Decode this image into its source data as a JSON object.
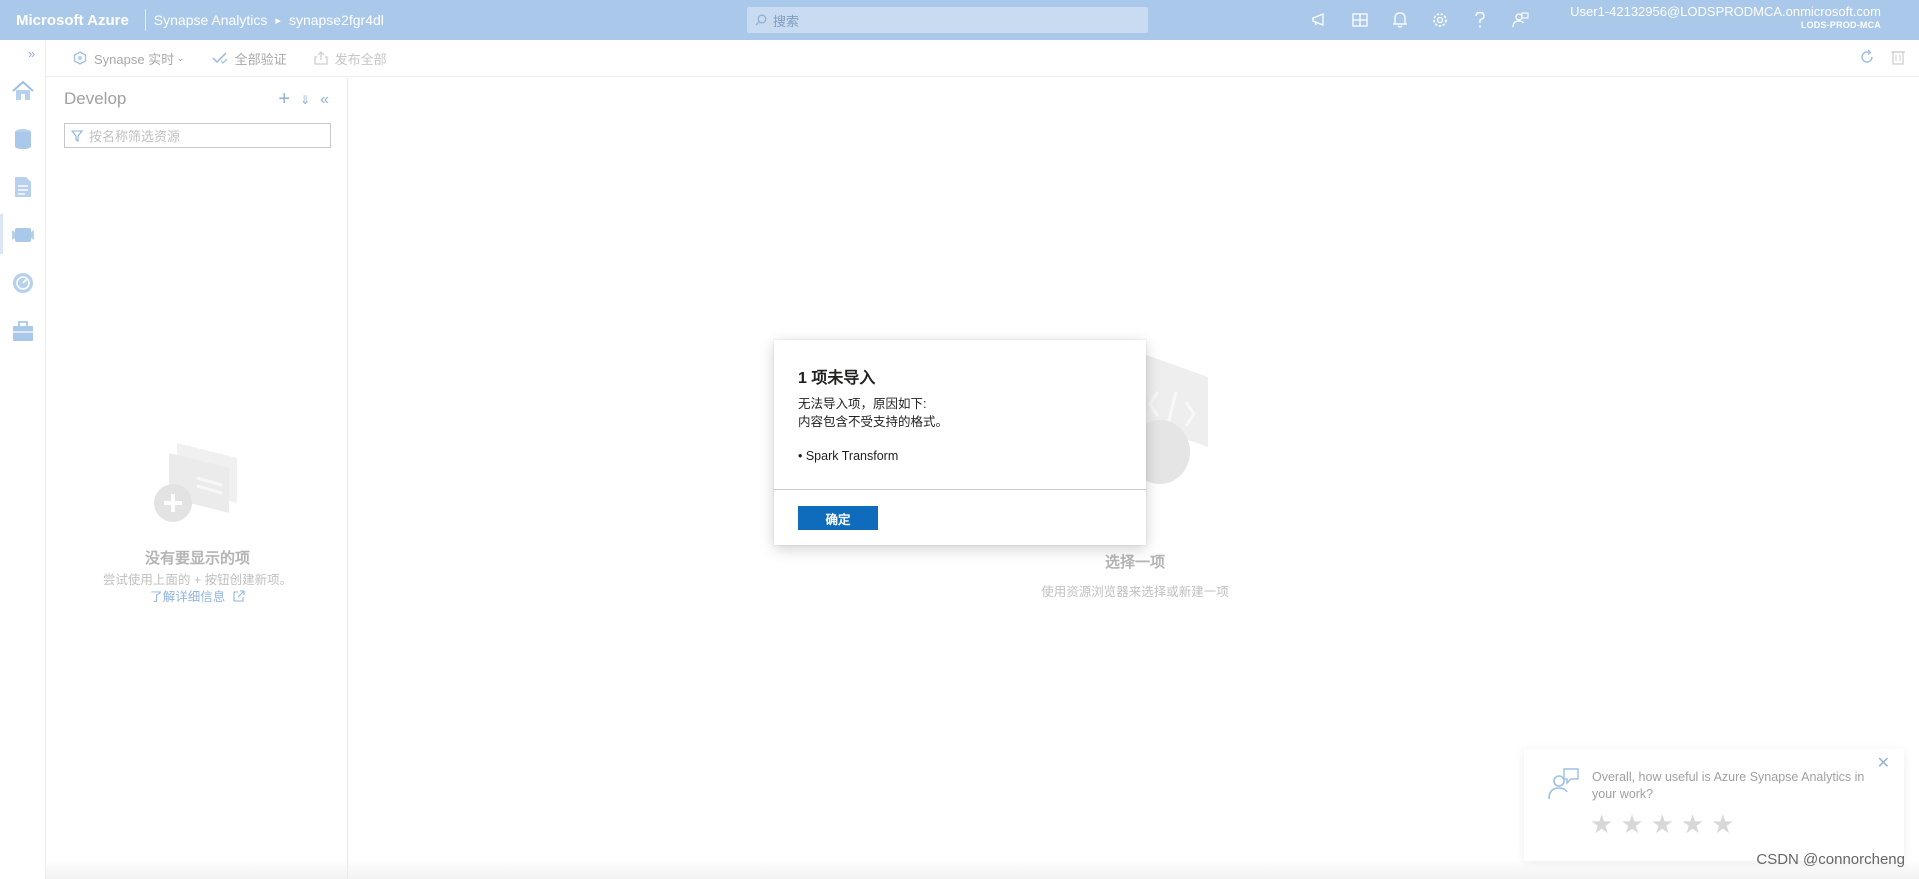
{
  "topbar": {
    "brand": "Microsoft Azure",
    "breadcrumb": [
      "Synapse Analytics",
      "synapse2fgr4dl"
    ],
    "search_placeholder": "搜索",
    "user_name": "User1-42132956@LODSPRODMCA.onmicrosoft.com",
    "user_org": "LODS-PROD-MCA",
    "icons": [
      "announcement-icon",
      "directory-icon",
      "bell-icon",
      "gear-icon",
      "help-icon",
      "feedback-icon"
    ]
  },
  "commandbar": {
    "live_label": "Synapse 实时",
    "validate_label": "全部验证",
    "publish_label": "发布全部"
  },
  "develop": {
    "title": "Develop",
    "filter_placeholder": "按名称筛选资源",
    "empty_title": "没有要显示的项",
    "empty_desc": "尝试使用上面的 + 按钮创建新项。",
    "empty_link": "了解详细信息"
  },
  "main": {
    "empty_title": "选择一项",
    "empty_desc": "使用资源浏览器来选择或新建一项"
  },
  "dialog": {
    "title": "1 项未导入",
    "line1": "无法导入项，原因如下:",
    "line2": "内容包含不受支持的格式。",
    "item": "• Spark Transform",
    "ok_label": "确定"
  },
  "feedback": {
    "question": "Overall, how useful is Azure Synapse Analytics in your work?",
    "star_glyph": "★",
    "star_count": 5
  },
  "watermark": "CSDN @connorcheng",
  "colors": {
    "topbar": "#a9c8ea",
    "primary_button": "#0f6cbd"
  }
}
